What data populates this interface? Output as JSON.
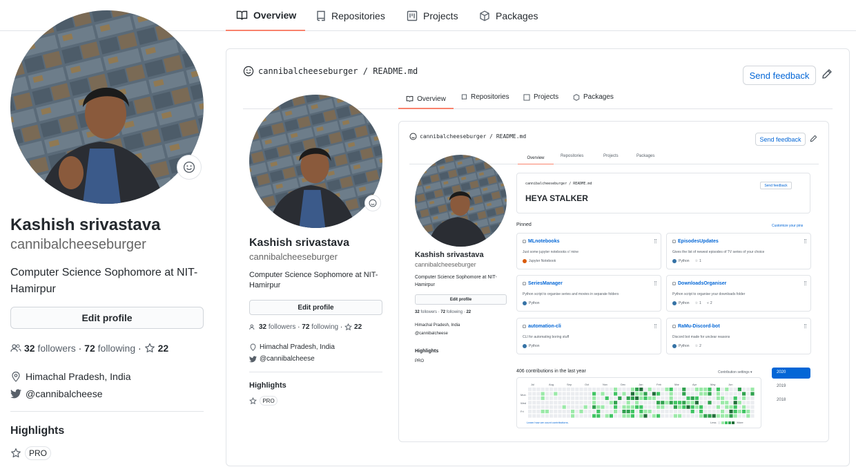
{
  "nav": {
    "tabs": [
      {
        "label": "Overview",
        "icon": "book-icon",
        "active": true
      },
      {
        "label": "Repositories",
        "icon": "repo-icon",
        "active": false
      },
      {
        "label": "Projects",
        "icon": "project-icon",
        "active": false
      },
      {
        "label": "Packages",
        "icon": "package-icon",
        "active": false
      }
    ],
    "accent_color": "#f9826c"
  },
  "profile": {
    "name": "Kashish srivastava",
    "login": "cannibalcheeseburger",
    "bio": "Computer Science Sophomore at NIT-Hamirpur",
    "bio_line1": "Computer Science Sophomore at NIT-",
    "bio_line2": "Hamirpur",
    "edit_label": "Edit profile",
    "followers_count": "32",
    "followers_label": "followers",
    "separator": "·",
    "following_count": "72",
    "following_label": "following",
    "stars_separator": "·",
    "stars_count": "22",
    "location": "Himachal Pradesh, India",
    "twitter": "@cannibalcheese",
    "highlights_title": "Highlights",
    "pro_badge": "PRO"
  },
  "readme": {
    "owner": "cannibalcheeseburger",
    "slash": "/",
    "file": "README.md",
    "feedback_label": "Send feedback"
  },
  "nested": {
    "greeting": "HEYA STALKER",
    "pinned_title": "Pinned",
    "customize_label": "Customize your pins",
    "pinned": [
      {
        "name": "MLnotebooks",
        "desc": "Just some jupyter notebooks o' mine",
        "lang": "Jupyter Notebook",
        "lang_color": "#DA5B0B",
        "stars": "",
        "forks": ""
      },
      {
        "name": "EpisodesUpdates",
        "desc": "Gives the list of newest episodes of TV series of your choice",
        "lang": "Python",
        "lang_color": "#3572A5",
        "stars": "1",
        "forks": ""
      },
      {
        "name": "SeriesManager",
        "desc": "Python script to organise series and movies in separate folders",
        "lang": "Python",
        "lang_color": "#3572A5",
        "stars": "",
        "forks": ""
      },
      {
        "name": "DownloadsOrganiser",
        "desc": "Python script to organise your downloads folder",
        "lang": "Python",
        "lang_color": "#3572A5",
        "stars": "1",
        "forks": "2"
      },
      {
        "name": "automation-cli",
        "desc": "CLI for automating boring stuff",
        "lang": "Python",
        "lang_color": "#3572A5",
        "stars": "",
        "forks": ""
      },
      {
        "name": "RaMu-Discord-bot",
        "desc": "Discord bot made for unclear reasons",
        "lang": "Python",
        "lang_color": "#3572A5",
        "stars": "2",
        "forks": ""
      }
    ],
    "contrib_title": "406 contributions in the last year",
    "contrib_settings": "Contribution settings ▾",
    "months": [
      "Jul",
      "Aug",
      "Sep",
      "Oct",
      "Nov",
      "Dec",
      "Jan",
      "Feb",
      "Mar",
      "Apr",
      "May",
      "Jun"
    ],
    "days": [
      "Mon",
      "Wed",
      "Fri"
    ],
    "learn_link": "Learn how we count contributions.",
    "less": "Less",
    "more": "More",
    "years": [
      "2020",
      "2019",
      "2018"
    ],
    "active_year": "2020",
    "active_year_color": "#0366d6"
  }
}
